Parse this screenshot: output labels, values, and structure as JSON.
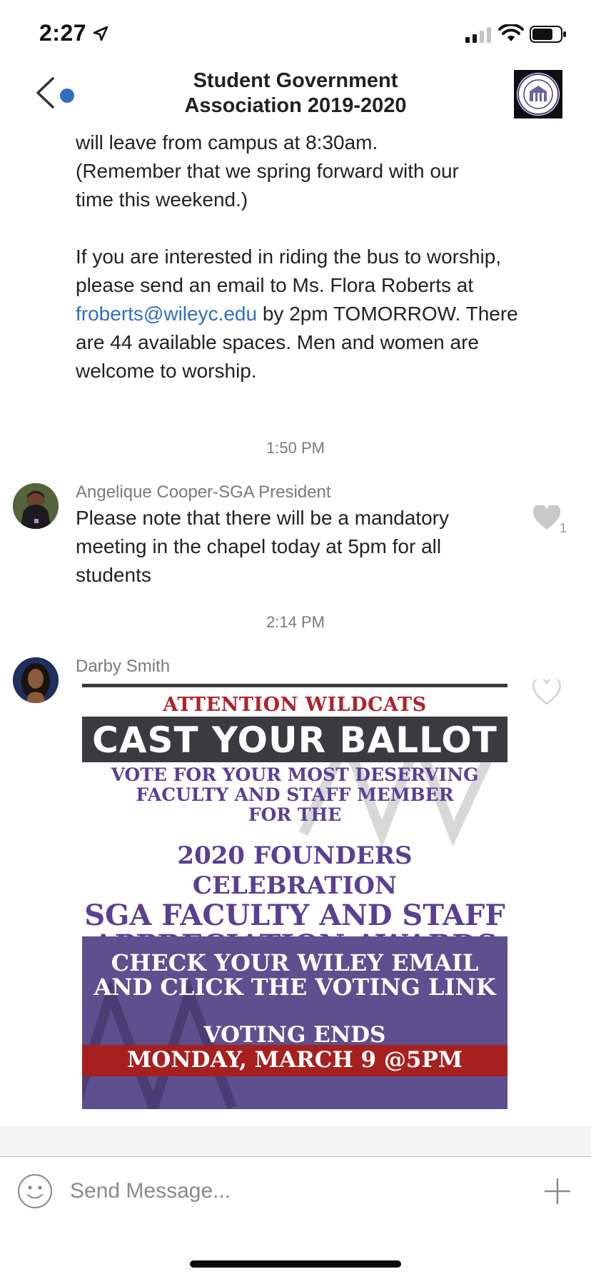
{
  "status_bar": {
    "time": "2:27"
  },
  "header": {
    "title_line1": "Student Government",
    "title_line2": "Association 2019-2020"
  },
  "messages": {
    "m1": {
      "line1": "will leave from campus at 8:30am.",
      "line2": "(Remember that we spring forward with our",
      "line3": "time this weekend.)",
      "p2_before_link": "If you are interested in riding the bus to worship, please send an email to Ms. Flora Roberts at ",
      "p2_link": "froberts@wileyc.edu",
      "p2_after_link": " by 2pm TOMORROW. There are 44 available spaces. Men and women are welcome to worship."
    },
    "t1": "1:50 PM",
    "m2": {
      "sender": "Angelique Cooper-SGA President",
      "text": "Please note that there will be a mandatory meeting in the chapel today at 5pm for all students",
      "likes": "1"
    },
    "t2": "2:14 PM",
    "m3": {
      "sender": "Darby Smith"
    }
  },
  "poster": {
    "attention": "ATTENTION WILDCATS",
    "cast": "CAST YOUR BALLOT",
    "vote1": "VOTE FOR YOUR MOST DESERVING",
    "vote2": "FACULTY AND STAFF MEMBER",
    "vote3": "FOR THE",
    "f1": "2020 FOUNDERS CELEBRATION",
    "f2": "SGA FACULTY AND STAFF",
    "f3": "APPRECIATION AWARDS",
    "check1": "CHECK YOUR WILEY EMAIL",
    "check2": "AND CLICK THE VOTING LINK",
    "ends": "VOTING ENDS",
    "deadline": "MONDAY, MARCH 9 @5PM"
  },
  "composer": {
    "placeholder": "Send Message..."
  },
  "colors": {
    "link": "#2f6fc1",
    "poster_purple": "#5e4f8e",
    "poster_red": "#a6201f",
    "poster_text_purple": "#5a3f93"
  }
}
